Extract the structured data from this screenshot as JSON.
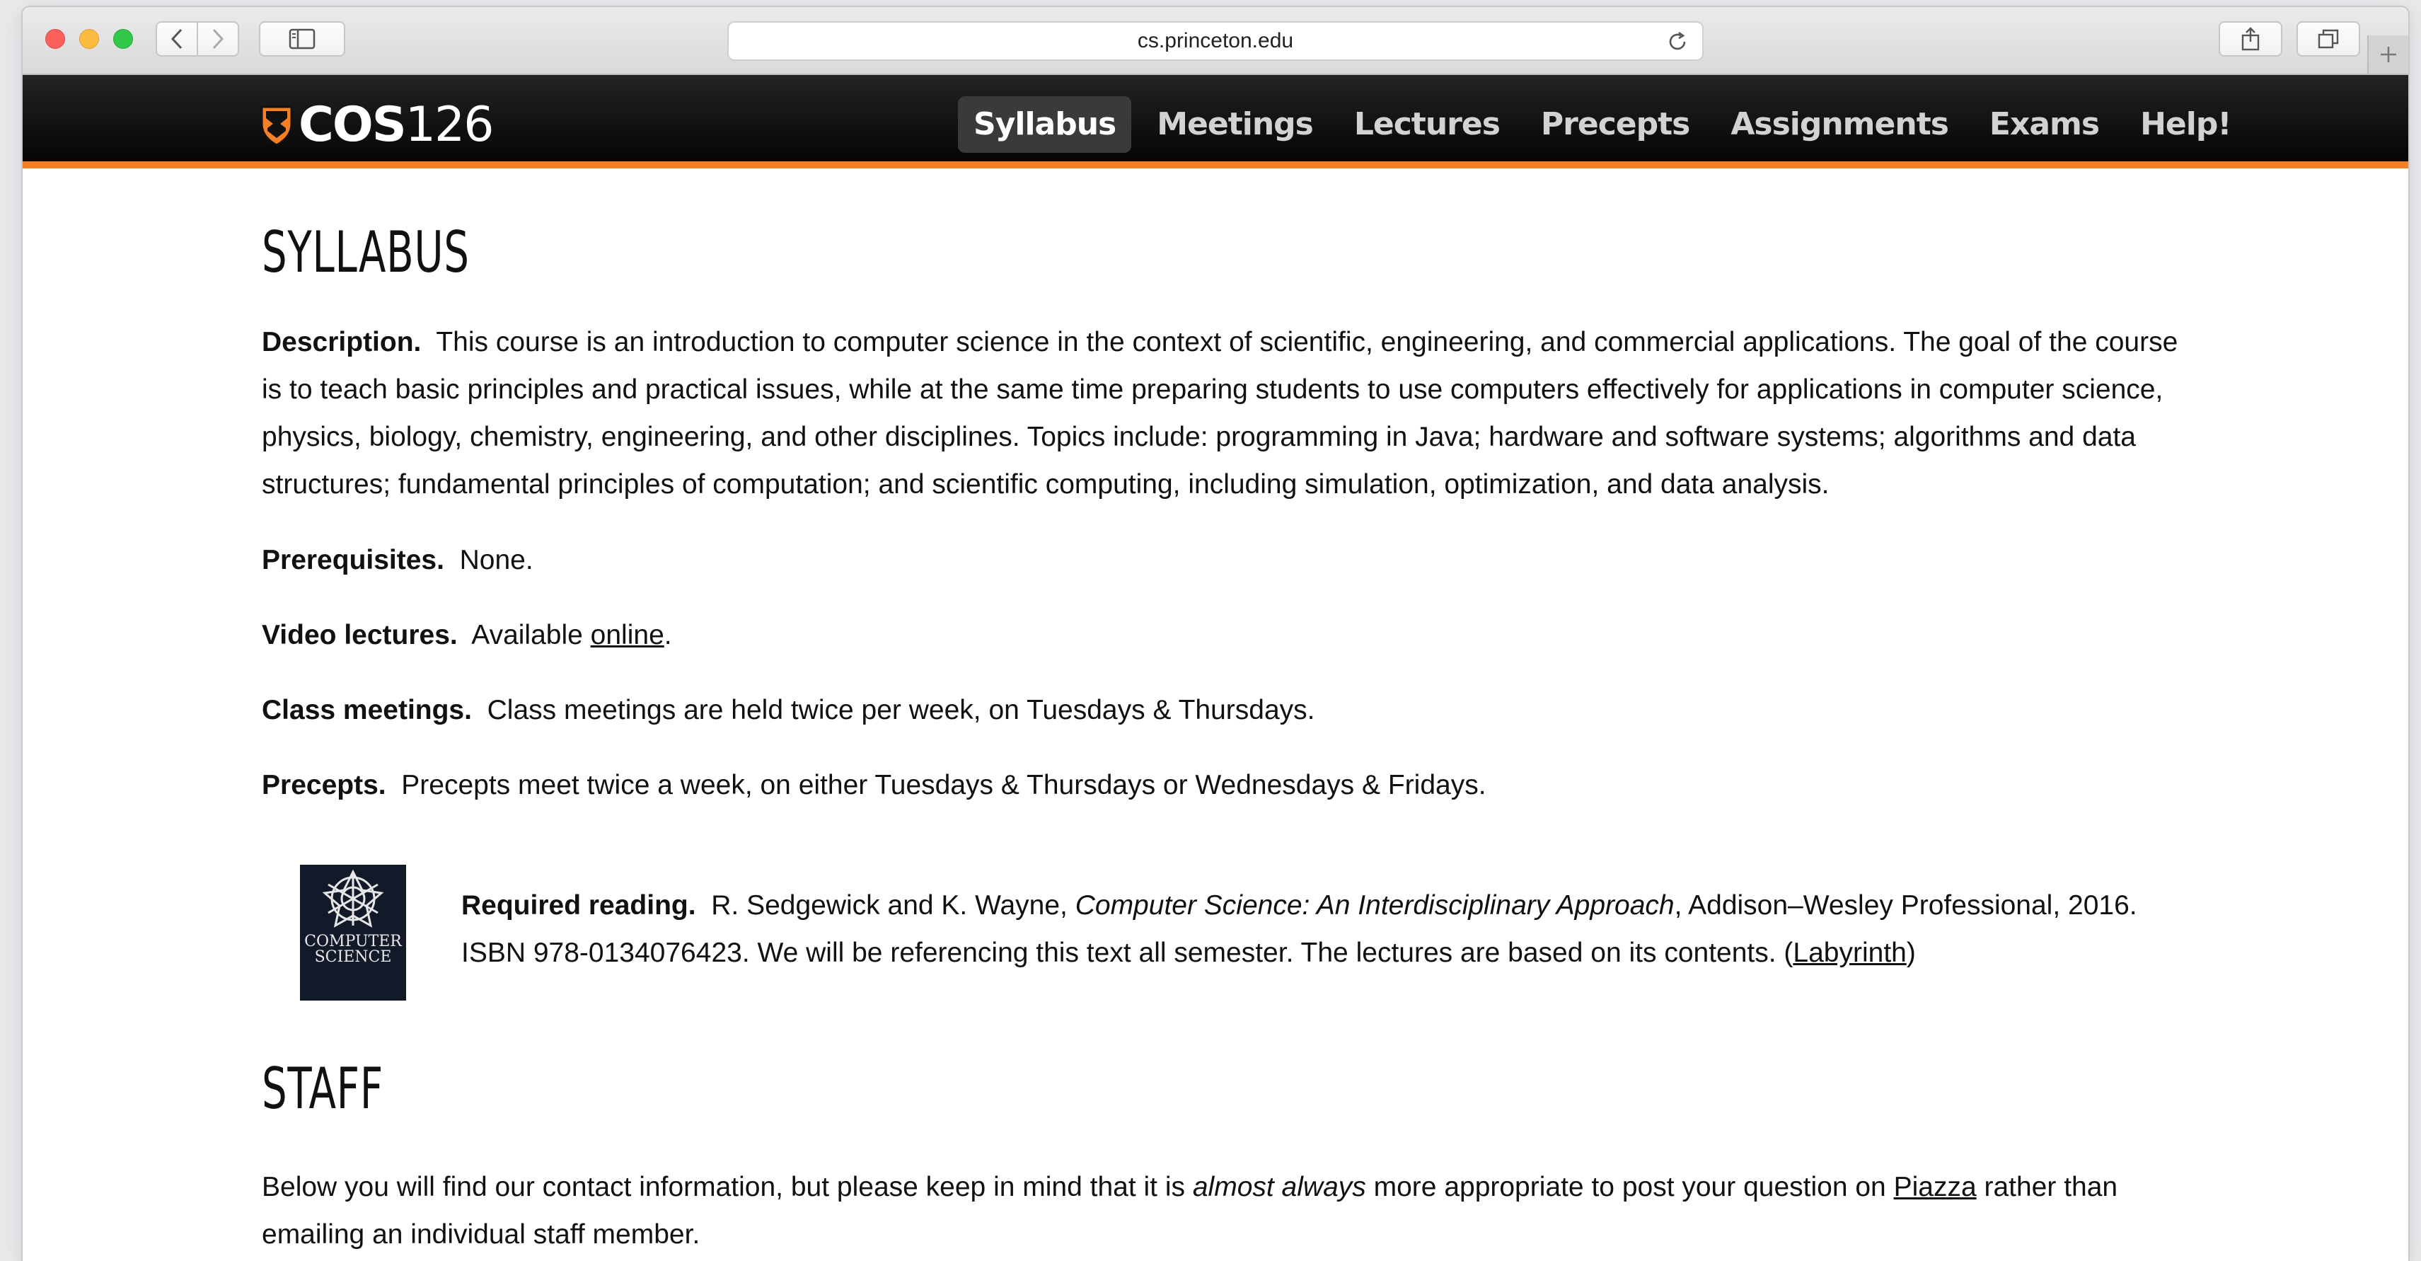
{
  "browser": {
    "url": "cs.princeton.edu"
  },
  "site": {
    "logo_bold": "COS",
    "logo_num": "126",
    "nav": [
      {
        "label": "Syllabus",
        "active": true
      },
      {
        "label": "Meetings",
        "active": false
      },
      {
        "label": "Lectures",
        "active": false
      },
      {
        "label": "Precepts",
        "active": false
      },
      {
        "label": "Assignments",
        "active": false
      },
      {
        "label": "Exams",
        "active": false
      },
      {
        "label": "Help!",
        "active": false
      }
    ],
    "accent_color": "#f58025"
  },
  "syllabus": {
    "heading": "SYLLABUS",
    "description": {
      "label": "Description.",
      "text": "This course is an introduction to computer science in the context of scientific, engineering, and commercial applications. The goal of the course is to teach basic principles and practical issues, while at the same time preparing students to use computers effectively for applications in computer science, physics, biology, chemistry, engineering, and other disciplines. Topics include: programming in Java; hardware and software systems; algorithms and data structures; fundamental principles of computation; and scientific computing, including simulation, optimization, and data analysis."
    },
    "prerequisites": {
      "label": "Prerequisites.",
      "text": "None."
    },
    "video": {
      "label": "Video lectures.",
      "text_before": "Available",
      "link": "online",
      "text_after": "."
    },
    "class_meetings": {
      "label": "Class meetings.",
      "text": "Class meetings are held twice per week, on Tuesdays & Thursdays."
    },
    "precepts": {
      "label": "Precepts.",
      "text": "Precepts meet twice a week, on either Tuesdays & Thursdays or Wednesdays & Fridays."
    },
    "reading": {
      "label": "Required reading.",
      "authors": "R. Sedgewick and K. Wayne,",
      "title": "Computer Science: An Interdisciplinary Approach",
      "publisher": ", Addison–Wesley Professional, 2016. ISBN 978-0134076423. We will be referencing this text all semester. The lectures are based on its contents. (",
      "link": "Labyrinth",
      "close": ")",
      "book_cover_title_1": "COMPUTER",
      "book_cover_title_2": "SCIENCE"
    }
  },
  "staff": {
    "heading": "STAFF",
    "text_before": "Below you will find our contact information, but please keep in mind that it is",
    "emphasis": "almost always",
    "text_middle": "more appropriate to post your question on",
    "link": "Piazza",
    "text_after": "rather than emailing an individual staff member."
  }
}
